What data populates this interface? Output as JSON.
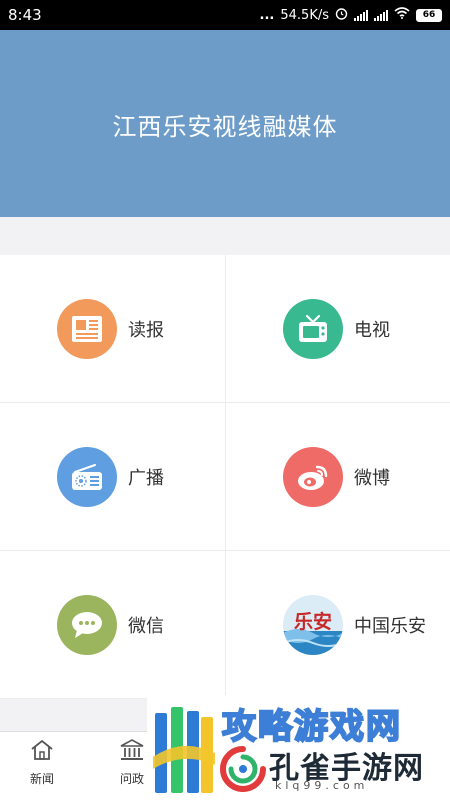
{
  "status_bar": {
    "time": "8:43",
    "dots": "...",
    "network_speed": "54.5K/s",
    "battery": "66",
    "icons": [
      "alarm-icon",
      "signal-icon",
      "signal-icon",
      "wifi-icon",
      "battery-icon"
    ]
  },
  "header": {
    "title": "江西乐安视线融媒体"
  },
  "grid": {
    "items": [
      {
        "label": "读报",
        "icon": "newspaper-icon",
        "color": "#f19a5c"
      },
      {
        "label": "电视",
        "icon": "tv-icon",
        "color": "#39b98f"
      },
      {
        "label": "广播",
        "icon": "radio-icon",
        "color": "#5f9ee0"
      },
      {
        "label": "微博",
        "icon": "weibo-icon",
        "color": "#ef6b67"
      },
      {
        "label": "微信",
        "icon": "wechat-icon",
        "color": "#9bb55f"
      },
      {
        "label": "中国乐安",
        "icon": "lean-logo-icon",
        "color": "#2d86c4",
        "logo_text": "乐安"
      }
    ]
  },
  "tabbar": {
    "tabs": [
      {
        "label": "新闻",
        "icon": "home-icon"
      },
      {
        "label": "问政",
        "icon": "government-icon"
      }
    ]
  },
  "watermark": {
    "top_text": "攻略游戏网",
    "main_text": "孔雀手游网",
    "site_text": "klq99.com"
  },
  "colors": {
    "header_bg": "#6e9cc9",
    "page_bg": "#f2f2f4"
  }
}
